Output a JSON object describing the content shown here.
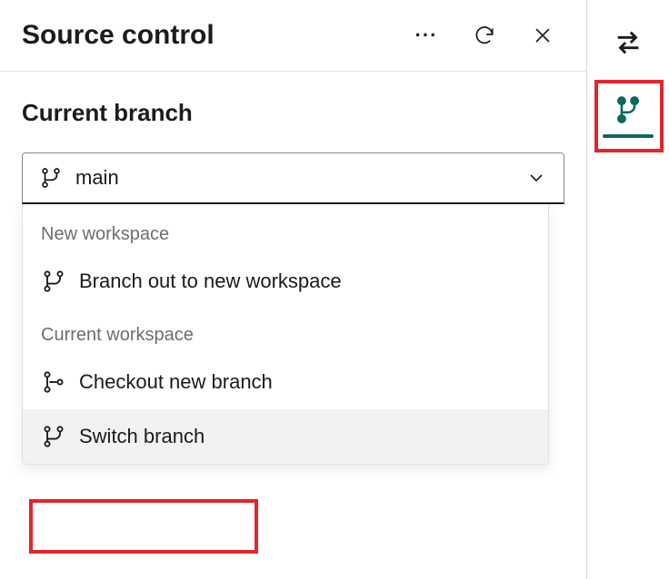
{
  "header": {
    "title": "Source control"
  },
  "section": {
    "title": "Current branch"
  },
  "dropdown": {
    "selected": "main"
  },
  "menu": {
    "group1_label": "New workspace",
    "item_branch_out": "Branch out to new workspace",
    "group2_label": "Current workspace",
    "item_checkout": "Checkout new branch",
    "item_switch": "Switch branch"
  },
  "colors": {
    "highlight": "#e3252c",
    "rail_selected": "#0b6a5d"
  }
}
